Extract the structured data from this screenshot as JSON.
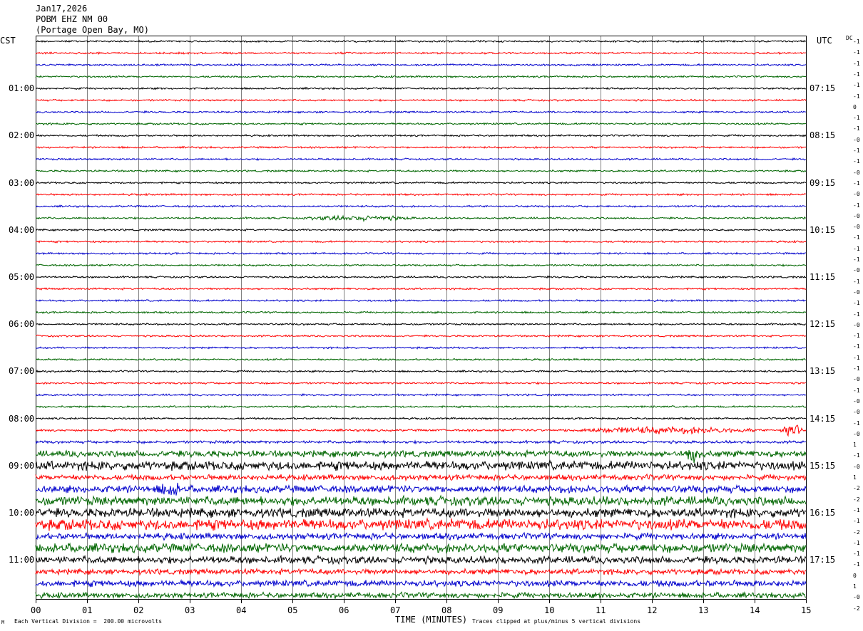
{
  "header": {
    "date": "Jan17,2026",
    "station": "POBM EHZ NM 00",
    "location": "(Portage Open Bay, MO)"
  },
  "axes": {
    "left_tz": "CST",
    "right_tz": "UTC",
    "dc_label": "DC",
    "xlabel": "TIME (MINUTES)",
    "footer_left": "Each Vertical Division =  200.00 microvolts",
    "footer_right": "Traces clipped at plus/minus 5 vertical divisions",
    "corner_mark": "M"
  },
  "colors": {
    "trace_cycle": [
      "#000000",
      "#ff0000",
      "#0000cc",
      "#006600"
    ],
    "grid": "#000000",
    "gridlines": "#808080"
  },
  "chart_data": {
    "type": "line",
    "title": "",
    "x_unit": "minutes",
    "xlim": [
      0,
      15
    ],
    "x_ticks": [
      "00",
      "01",
      "02",
      "03",
      "04",
      "05",
      "06",
      "07",
      "08",
      "09",
      "10",
      "11",
      "12",
      "13",
      "14",
      "15"
    ],
    "left_hour_labels": [
      "01:00",
      "02:00",
      "03:00",
      "04:00",
      "05:00",
      "06:00",
      "07:00",
      "08:00",
      "09:00",
      "10:00",
      "11:00"
    ],
    "right_hour_labels": [
      "07:15",
      "08:15",
      "09:15",
      "10:15",
      "11:15",
      "12:15",
      "13:15",
      "14:15",
      "15:15",
      "16:15",
      "17:15"
    ],
    "traces_count": 48,
    "dc_offsets": [
      "-1",
      "-1",
      "-1",
      "-1",
      "-1",
      "-1",
      "0",
      "-1",
      "-1",
      "-0",
      "-1",
      "-1",
      "-0",
      "-1",
      "-0",
      "-1",
      "-0",
      "-0",
      "-1",
      "-1",
      "-1",
      "-0",
      "-1",
      "-0",
      "-1",
      "-1",
      "-0",
      "-1",
      "-1",
      "-1",
      "-1",
      "-0",
      "-1",
      "-0",
      "-0",
      "-1",
      "-0",
      "1",
      "-1",
      "-0",
      "1",
      "-2",
      "-2",
      "-1",
      "-1",
      "-2",
      "-1",
      "-1",
      "-1",
      "0",
      "1",
      "-0",
      "-2"
    ],
    "noise_amplitude": [
      1,
      1,
      1,
      1,
      1,
      1,
      1,
      1,
      1,
      1,
      1,
      1,
      1,
      1,
      1,
      1,
      1,
      1,
      1,
      1,
      1,
      1,
      1,
      1,
      1,
      1,
      1,
      1,
      1,
      1,
      1,
      1,
      1,
      1.2,
      1.5,
      3.5,
      5,
      3,
      4,
      5,
      5,
      6,
      3.5,
      5,
      4,
      3,
      3.5,
      3,
      3.5
    ],
    "events": [
      {
        "trace": 15,
        "start_min": 5,
        "end_min": 8,
        "amp": 3
      },
      {
        "trace": 33,
        "start_min": 10,
        "end_min": 15,
        "amp": 4
      },
      {
        "trace": 33,
        "start_min": 14.5,
        "end_min": 15,
        "amp": 9
      },
      {
        "trace": 35,
        "start_min": 12.5,
        "end_min": 13.2,
        "amp": 9
      },
      {
        "trace": 38,
        "start_min": 2.3,
        "end_min": 3,
        "amp": 9
      }
    ]
  }
}
